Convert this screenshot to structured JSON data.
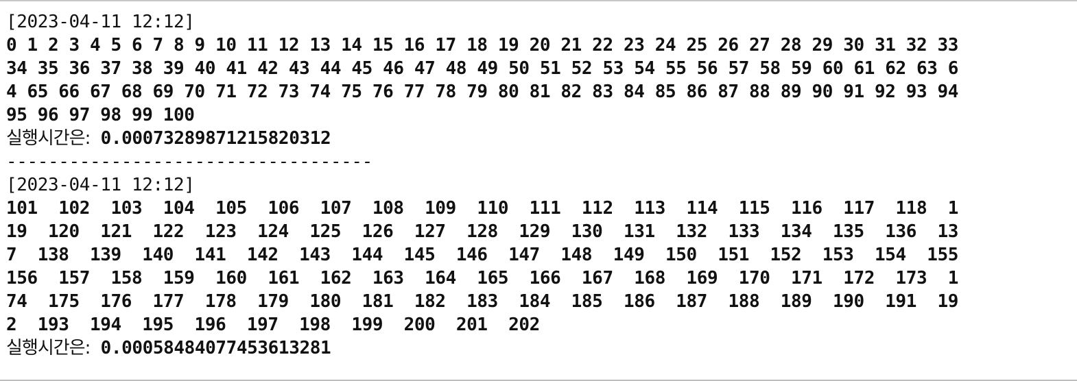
{
  "output": {
    "blocks": [
      {
        "timestamp": "[2023-04-11 12:12]",
        "lines": [
          "0 1 2 3 4 5 6 7 8 9 10 11 12 13 14 15 16 17 18 19 20 21 22 23 24 25 26 27 28 29 30 31 32 33",
          "34 35 36 37 38 39 40 41 42 43 44 45 46 47 48 49 50 51 52 53 54 55 56 57 58 59 60 61 62 63 6",
          "4 65 66 67 68 69 70 71 72 73 74 75 76 77 78 79 80 81 82 83 84 85 86 87 88 89 90 91 92 93 94",
          "95 96 97 98 99 100"
        ],
        "time_label": "실행시간은:",
        "time_value": " 0.00073289871215820312"
      },
      {
        "separator": "-----------------------------------",
        "timestamp": "[2023-04-11 12:12]",
        "lines": [
          "101  102  103  104  105  106  107  108  109  110  111  112  113  114  115  116  117  118  1",
          "19  120  121  122  123  124  125  126  127  128  129  130  131  132  133  134  135  136  13",
          "7  138  139  140  141  142  143  144  145  146  147  148  149  150  151  152  153  154  155",
          "156  157  158  159  160  161  162  163  164  165  166  167  168  169  170  171  172  173  1",
          "74  175  176  177  178  179  180  181  182  183  184  185  186  187  188  189  190  191  19",
          "2  193  194  195  196  197  198  199  200  201  202"
        ],
        "time_label": "실행시간은:",
        "time_value": " 0.00058484077453613281"
      }
    ]
  }
}
